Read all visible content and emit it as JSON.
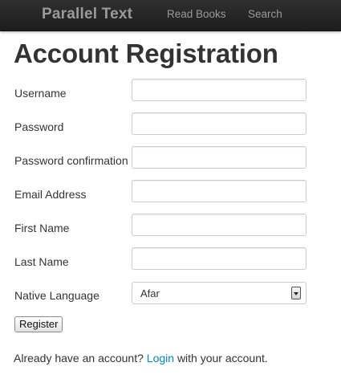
{
  "navbar": {
    "brand": "Parallel Text",
    "links": [
      "Read Books",
      "Search"
    ]
  },
  "page": {
    "title": "Account Registration"
  },
  "form": {
    "fields": [
      {
        "label": "Username",
        "value": ""
      },
      {
        "label": "Password",
        "value": ""
      },
      {
        "label": "Password confirmation",
        "value": ""
      },
      {
        "label": "Email Address",
        "value": ""
      },
      {
        "label": "First Name",
        "value": ""
      },
      {
        "label": "Last Name",
        "value": ""
      }
    ],
    "native_language": {
      "label": "Native Language",
      "selected": "Afar"
    },
    "submit_label": "Register"
  },
  "footer": {
    "before": "Already have an account?",
    "link": "Login",
    "after": "with your account."
  },
  "colors": {
    "navbar_bg": "#222222",
    "nav_text": "#9a9a9a",
    "link": "#0088cc",
    "text": "#333333"
  }
}
